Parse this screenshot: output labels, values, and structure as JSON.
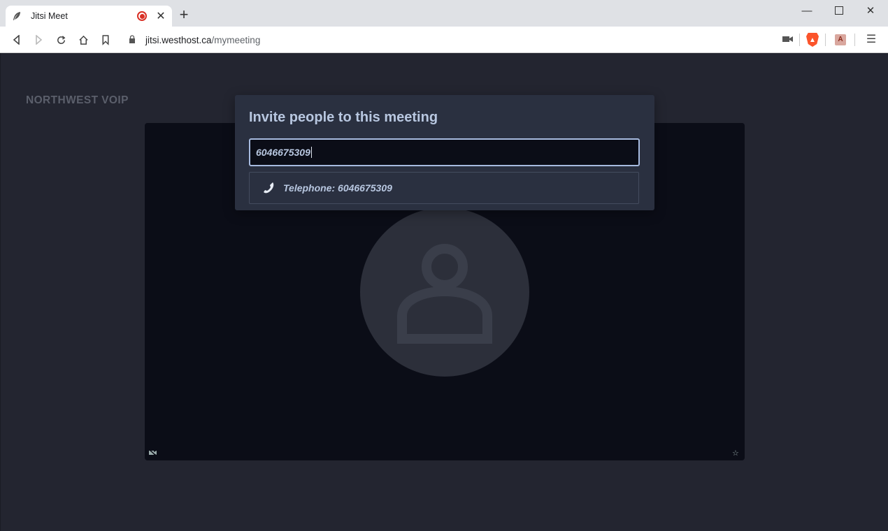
{
  "browser": {
    "tab": {
      "title": "Jitsi Meet",
      "favicon": "feather-icon",
      "recording": true
    },
    "url": {
      "host": "jitsi.westhost.ca",
      "path": "/mymeeting"
    }
  },
  "page": {
    "brand": "NORTHWEST VOIP",
    "avatar_icon": "user-icon"
  },
  "dialog": {
    "title": "Invite people to this meeting",
    "input_value": "6046675309",
    "suggestion": {
      "icon": "phone-icon",
      "text": "Telephone: 6046675309"
    }
  },
  "colors": {
    "background": "#232530",
    "stage": "#0b0d17",
    "dialog": "#2a3040",
    "accent": "#a7bbe0",
    "text": "#b8c7e0"
  }
}
